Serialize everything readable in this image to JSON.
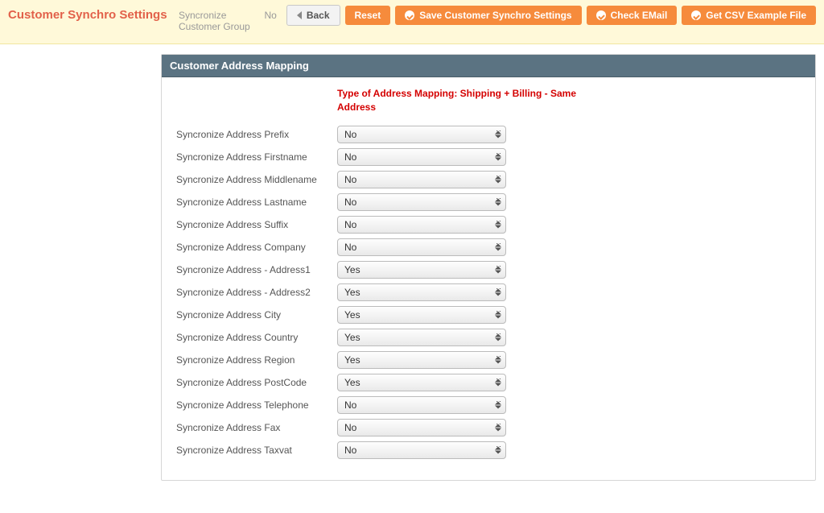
{
  "header": {
    "title": "Customer Synchro Settings",
    "inline_field_label": "Syncronize Customer Group",
    "inline_field_value": "No",
    "buttons": {
      "back": "Back",
      "reset": "Reset",
      "save": "Save Customer Synchro Settings",
      "check_email": "Check EMail",
      "get_csv": "Get CSV Example File"
    }
  },
  "panel": {
    "title": "Customer Address Mapping",
    "note": "Type of Address Mapping: Shipping + Billing - Same Address",
    "rows": [
      {
        "label": "Syncronize Address Prefix",
        "value": "No"
      },
      {
        "label": "Syncronize Address Firstname",
        "value": "No"
      },
      {
        "label": "Syncronize Address Middlename",
        "value": "No"
      },
      {
        "label": "Syncronize Address Lastname",
        "value": "No"
      },
      {
        "label": "Syncronize Address Suffix",
        "value": "No"
      },
      {
        "label": "Syncronize Address Company",
        "value": "No"
      },
      {
        "label": "Syncronize Address - Address1",
        "value": "Yes"
      },
      {
        "label": "Syncronize Address - Address2",
        "value": "Yes"
      },
      {
        "label": "Syncronize Address City",
        "value": "Yes"
      },
      {
        "label": "Syncronize Address Country",
        "value": "Yes"
      },
      {
        "label": "Syncronize Address Region",
        "value": "Yes"
      },
      {
        "label": "Syncronize Address PostCode",
        "value": "Yes"
      },
      {
        "label": "Syncronize Address Telephone",
        "value": "No"
      },
      {
        "label": "Syncronize Address Fax",
        "value": "No"
      },
      {
        "label": "Syncronize Address Taxvat",
        "value": "No"
      }
    ],
    "select_options": [
      "No",
      "Yes"
    ]
  }
}
